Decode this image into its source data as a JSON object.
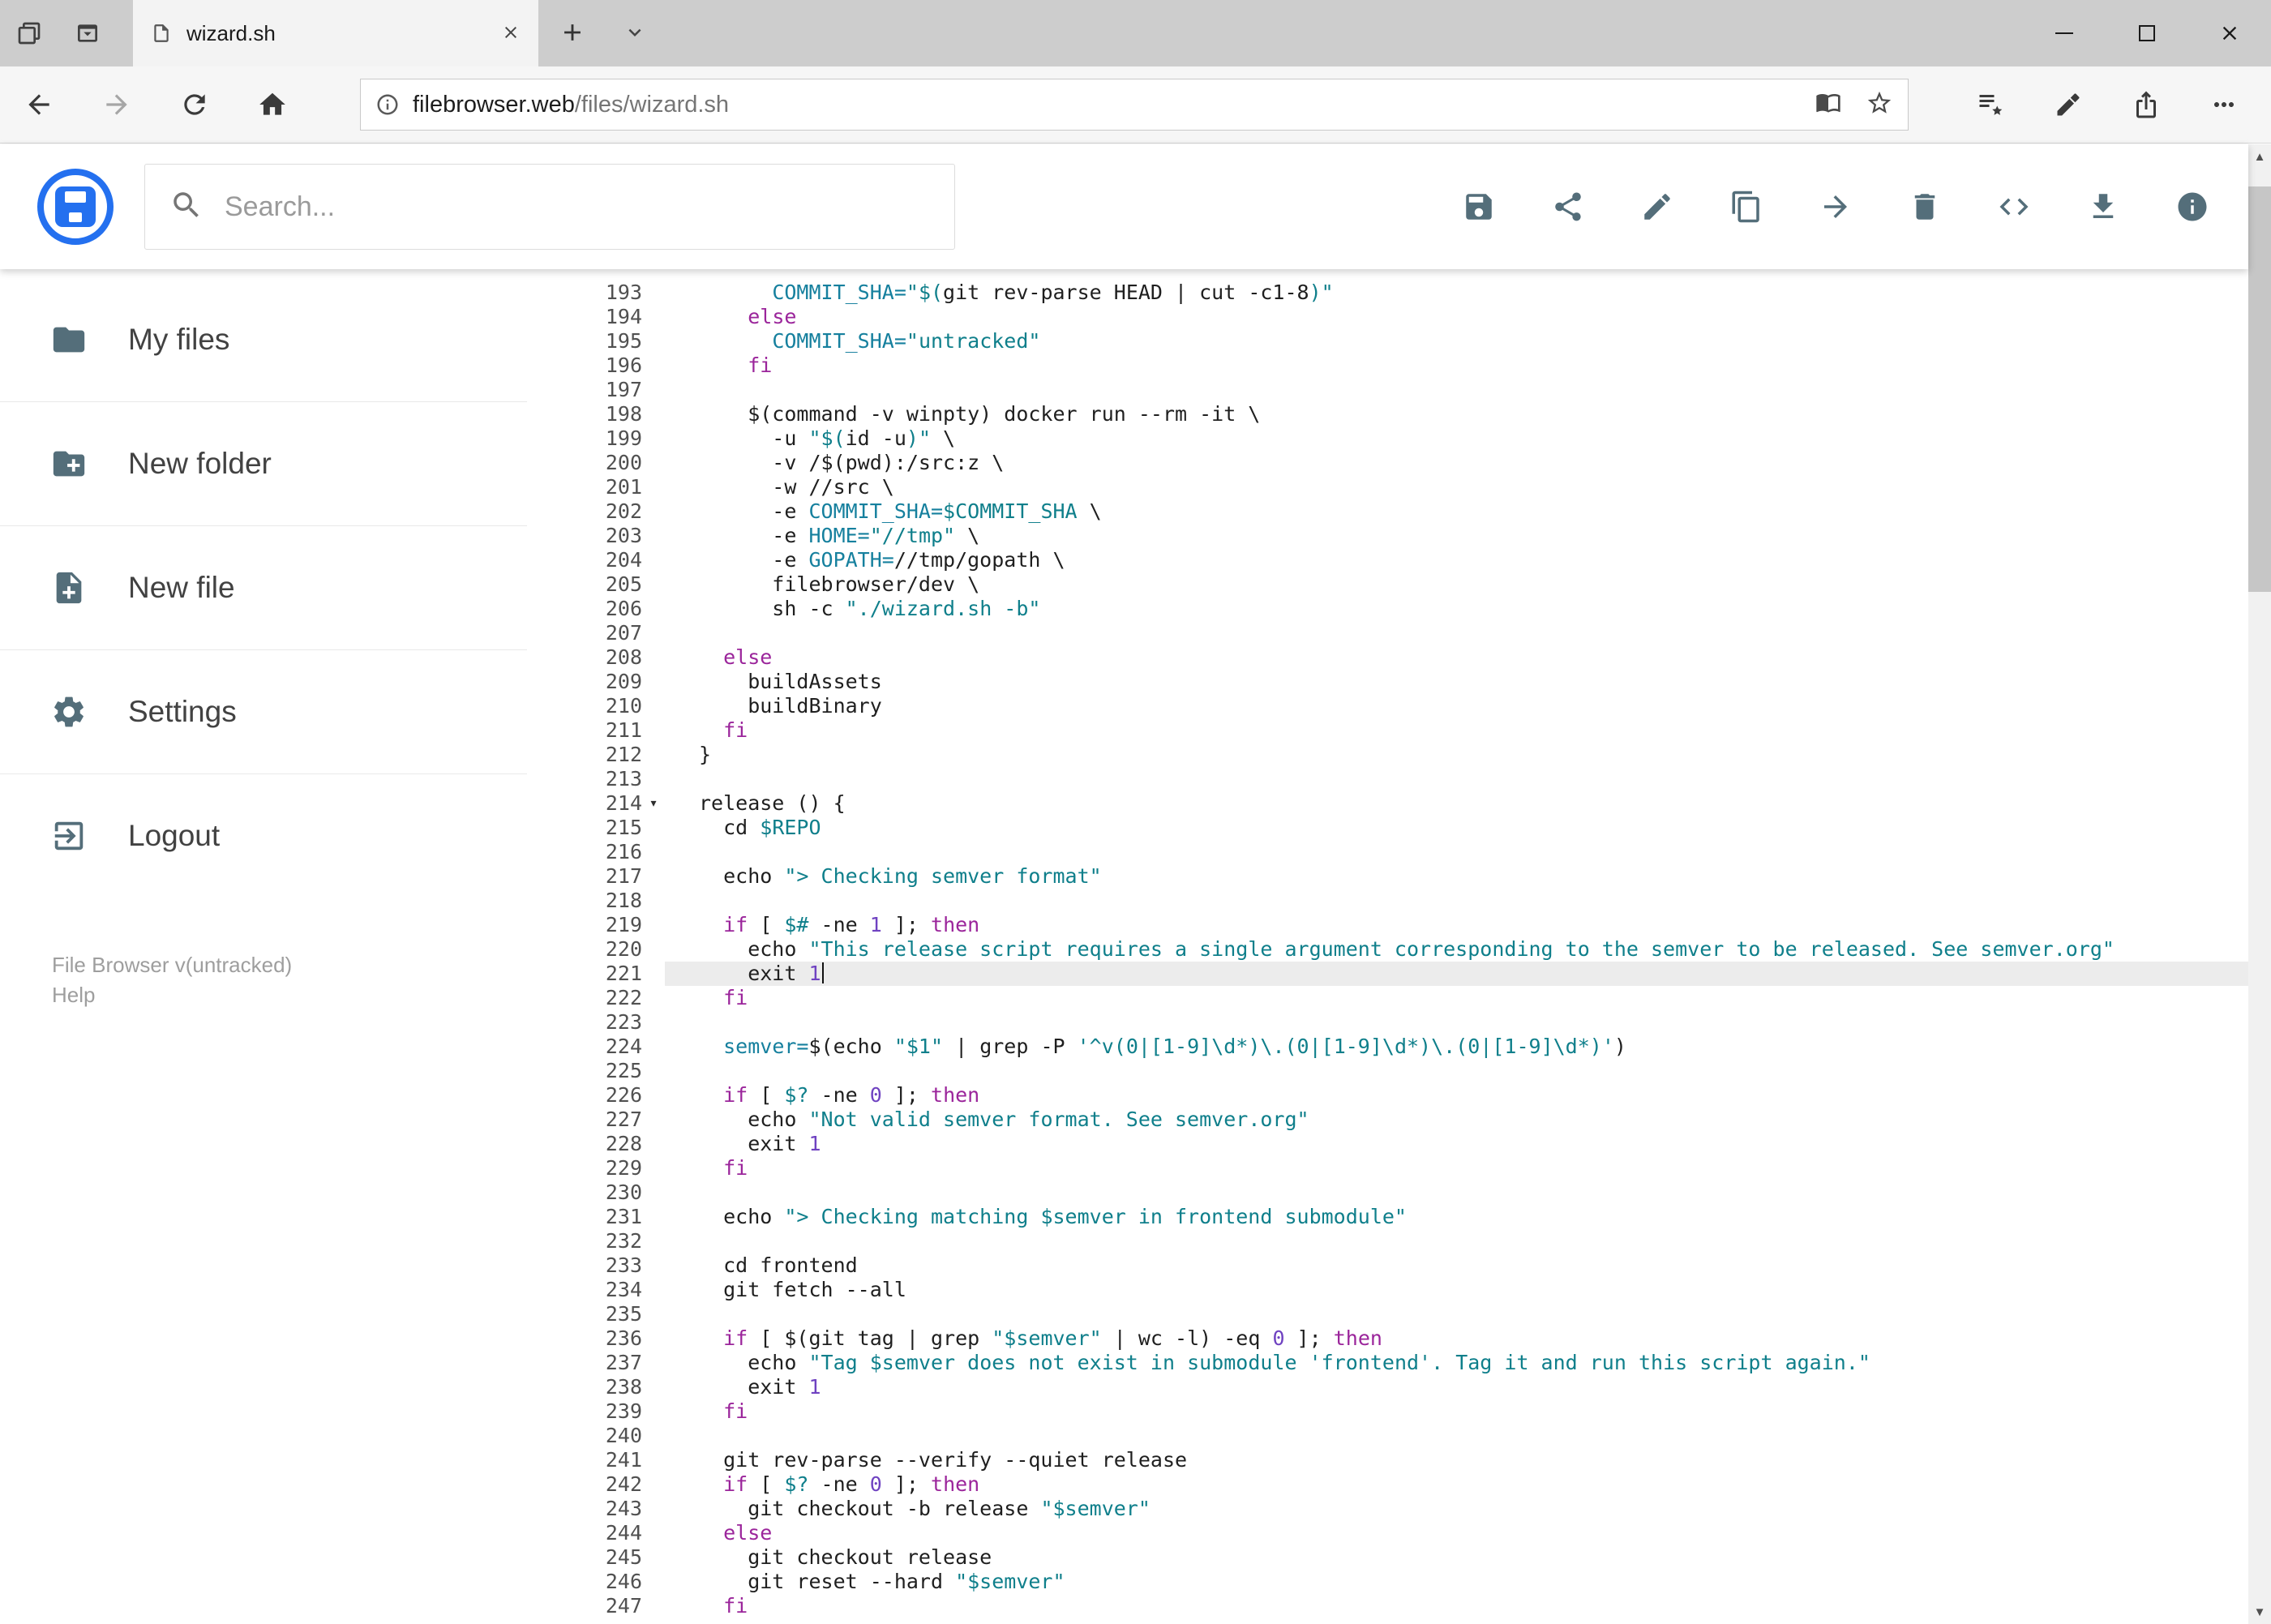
{
  "colors": {
    "brand_blue": "#2470ef",
    "toolbar_icon_gray": "#546e7a",
    "syntax_keyword": "#9b259b",
    "syntax_string": "#0f7f8b",
    "syntax_definition": "#16809e",
    "syntax_number": "#6f42c1",
    "syntax_plain": "#1f1f1f",
    "active_line_bg": "#ececec"
  },
  "browser": {
    "tab_title": "wizard.sh",
    "url_host": "filebrowser.web",
    "url_path": "/files/wizard.sh",
    "tabstrip_icons": [
      "tabs-aside-icon",
      "tab-preview-icon"
    ],
    "nav_icons": [
      "back-icon",
      "forward-icon",
      "refresh-icon",
      "home-icon"
    ],
    "address_icons": [
      "page-info-icon",
      "reading-view-icon",
      "favorite-star-icon"
    ],
    "action_icons": [
      "hub-icon",
      "web-note-icon",
      "share-browser-icon",
      "more-icon"
    ]
  },
  "app": {
    "search_placeholder": "Search...",
    "toolbar_icons": [
      "save-icon",
      "share-icon",
      "edit-icon",
      "copy-icon",
      "move-icon",
      "delete-icon",
      "code-icon",
      "download-icon",
      "info-icon"
    ]
  },
  "sidebar": {
    "items": [
      {
        "icon": "folder-icon",
        "label": "My files"
      },
      {
        "icon": "new-folder-icon",
        "label": "New folder"
      },
      {
        "icon": "new-file-icon",
        "label": "New file"
      },
      {
        "icon": "settings-icon",
        "label": "Settings"
      },
      {
        "icon": "logout-icon",
        "label": "Logout"
      }
    ],
    "footer": {
      "version": "File Browser v(untracked)",
      "help": "Help"
    }
  },
  "editor": {
    "active_line": 221,
    "fold_line": 214,
    "lines": [
      {
        "n": 193,
        "t": [
          [
            "p",
            "      "
          ],
          [
            "d",
            "COMMIT_SHA="
          ],
          [
            "s",
            "\"$("
          ],
          [
            "p",
            "git rev-parse HEAD | cut -c1-8"
          ],
          [
            "s",
            ")\""
          ]
        ]
      },
      {
        "n": 194,
        "t": [
          [
            "p",
            "    "
          ],
          [
            "k",
            "else"
          ]
        ]
      },
      {
        "n": 195,
        "t": [
          [
            "p",
            "      "
          ],
          [
            "d",
            "COMMIT_SHA="
          ],
          [
            "s",
            "\"untracked\""
          ]
        ]
      },
      {
        "n": 196,
        "t": [
          [
            "p",
            "    "
          ],
          [
            "k",
            "fi"
          ]
        ]
      },
      {
        "n": 197,
        "t": []
      },
      {
        "n": 198,
        "t": [
          [
            "p",
            "    $(command -v winpty) docker run --rm -it \\"
          ]
        ]
      },
      {
        "n": 199,
        "t": [
          [
            "p",
            "      -u "
          ],
          [
            "s",
            "\"$("
          ],
          [
            "p",
            "id -u"
          ],
          [
            "s",
            ")\""
          ],
          [
            "p",
            " \\"
          ]
        ]
      },
      {
        "n": 200,
        "t": [
          [
            "p",
            "      -v /$(pwd):/src:z \\"
          ]
        ]
      },
      {
        "n": 201,
        "t": [
          [
            "p",
            "      -w //src \\"
          ]
        ]
      },
      {
        "n": 202,
        "t": [
          [
            "p",
            "      -e "
          ],
          [
            "d",
            "COMMIT_SHA="
          ],
          [
            "v",
            "$COMMIT_SHA"
          ],
          [
            "p",
            " \\"
          ]
        ]
      },
      {
        "n": 203,
        "t": [
          [
            "p",
            "      -e "
          ],
          [
            "d",
            "HOME="
          ],
          [
            "s",
            "\"//tmp\""
          ],
          [
            "p",
            " \\"
          ]
        ]
      },
      {
        "n": 204,
        "t": [
          [
            "p",
            "      -e "
          ],
          [
            "d",
            "GOPATH="
          ],
          [
            "p",
            "//tmp/gopath \\"
          ]
        ]
      },
      {
        "n": 205,
        "t": [
          [
            "p",
            "      filebrowser/dev \\"
          ]
        ]
      },
      {
        "n": 206,
        "t": [
          [
            "p",
            "      sh -c "
          ],
          [
            "s",
            "\"./wizard.sh -b\""
          ]
        ]
      },
      {
        "n": 207,
        "t": []
      },
      {
        "n": 208,
        "t": [
          [
            "p",
            "  "
          ],
          [
            "k",
            "else"
          ]
        ]
      },
      {
        "n": 209,
        "t": [
          [
            "p",
            "    buildAssets"
          ]
        ]
      },
      {
        "n": 210,
        "t": [
          [
            "p",
            "    buildBinary"
          ]
        ]
      },
      {
        "n": 211,
        "t": [
          [
            "p",
            "  "
          ],
          [
            "k",
            "fi"
          ]
        ]
      },
      {
        "n": 212,
        "t": [
          [
            "p",
            "}"
          ]
        ]
      },
      {
        "n": 213,
        "t": []
      },
      {
        "n": 214,
        "t": [
          [
            "p",
            "release () {"
          ]
        ]
      },
      {
        "n": 215,
        "t": [
          [
            "p",
            "  cd "
          ],
          [
            "v",
            "$REPO"
          ]
        ]
      },
      {
        "n": 216,
        "t": []
      },
      {
        "n": 217,
        "t": [
          [
            "p",
            "  echo "
          ],
          [
            "s",
            "\"> Checking semver format\""
          ]
        ]
      },
      {
        "n": 218,
        "t": []
      },
      {
        "n": 219,
        "t": [
          [
            "p",
            "  "
          ],
          [
            "k",
            "if"
          ],
          [
            "p",
            " [ "
          ],
          [
            "v",
            "$#"
          ],
          [
            "p",
            " -ne "
          ],
          [
            "n",
            "1"
          ],
          [
            "p",
            " ]; "
          ],
          [
            "k",
            "then"
          ]
        ]
      },
      {
        "n": 220,
        "t": [
          [
            "p",
            "    echo "
          ],
          [
            "s",
            "\"This release script requires a single argument corresponding to the semver to be released. See semver.org\""
          ]
        ]
      },
      {
        "n": 221,
        "t": [
          [
            "p",
            "    exit "
          ],
          [
            "n",
            "1"
          ]
        ]
      },
      {
        "n": 222,
        "t": [
          [
            "p",
            "  "
          ],
          [
            "k",
            "fi"
          ]
        ]
      },
      {
        "n": 223,
        "t": []
      },
      {
        "n": 224,
        "t": [
          [
            "p",
            "  "
          ],
          [
            "d",
            "semver="
          ],
          [
            "p",
            "$(echo "
          ],
          [
            "s",
            "\"$1\""
          ],
          [
            "p",
            " | grep -P "
          ],
          [
            "s",
            "'^v(0|[1-9]\\d*)\\.(0|[1-9]\\d*)\\.(0|[1-9]\\d*)'"
          ],
          [
            "p",
            ")"
          ]
        ]
      },
      {
        "n": 225,
        "t": []
      },
      {
        "n": 226,
        "t": [
          [
            "p",
            "  "
          ],
          [
            "k",
            "if"
          ],
          [
            "p",
            " [ "
          ],
          [
            "v",
            "$?"
          ],
          [
            "p",
            " -ne "
          ],
          [
            "n",
            "0"
          ],
          [
            "p",
            " ]; "
          ],
          [
            "k",
            "then"
          ]
        ]
      },
      {
        "n": 227,
        "t": [
          [
            "p",
            "    echo "
          ],
          [
            "s",
            "\"Not valid semver format. See semver.org\""
          ]
        ]
      },
      {
        "n": 228,
        "t": [
          [
            "p",
            "    exit "
          ],
          [
            "n",
            "1"
          ]
        ]
      },
      {
        "n": 229,
        "t": [
          [
            "p",
            "  "
          ],
          [
            "k",
            "fi"
          ]
        ]
      },
      {
        "n": 230,
        "t": []
      },
      {
        "n": 231,
        "t": [
          [
            "p",
            "  echo "
          ],
          [
            "s",
            "\"> Checking matching "
          ],
          [
            "v",
            "$semver"
          ],
          [
            "s",
            " in frontend submodule\""
          ]
        ]
      },
      {
        "n": 232,
        "t": []
      },
      {
        "n": 233,
        "t": [
          [
            "p",
            "  cd frontend"
          ]
        ]
      },
      {
        "n": 234,
        "t": [
          [
            "p",
            "  git fetch --all"
          ]
        ]
      },
      {
        "n": 235,
        "t": []
      },
      {
        "n": 236,
        "t": [
          [
            "p",
            "  "
          ],
          [
            "k",
            "if"
          ],
          [
            "p",
            " [ $(git tag | grep "
          ],
          [
            "s",
            "\"$semver\""
          ],
          [
            "p",
            " | wc -l) -eq "
          ],
          [
            "n",
            "0"
          ],
          [
            "p",
            " ]; "
          ],
          [
            "k",
            "then"
          ]
        ]
      },
      {
        "n": 237,
        "t": [
          [
            "p",
            "    echo "
          ],
          [
            "s",
            "\"Tag "
          ],
          [
            "v",
            "$semver"
          ],
          [
            "s",
            " does not exist in submodule 'frontend'. Tag it and run this script again.\""
          ]
        ]
      },
      {
        "n": 238,
        "t": [
          [
            "p",
            "    exit "
          ],
          [
            "n",
            "1"
          ]
        ]
      },
      {
        "n": 239,
        "t": [
          [
            "p",
            "  "
          ],
          [
            "k",
            "fi"
          ]
        ]
      },
      {
        "n": 240,
        "t": []
      },
      {
        "n": 241,
        "t": [
          [
            "p",
            "  git rev-parse --verify --quiet release"
          ]
        ]
      },
      {
        "n": 242,
        "t": [
          [
            "p",
            "  "
          ],
          [
            "k",
            "if"
          ],
          [
            "p",
            " [ "
          ],
          [
            "v",
            "$?"
          ],
          [
            "p",
            " -ne "
          ],
          [
            "n",
            "0"
          ],
          [
            "p",
            " ]; "
          ],
          [
            "k",
            "then"
          ]
        ]
      },
      {
        "n": 243,
        "t": [
          [
            "p",
            "    git checkout -b release "
          ],
          [
            "s",
            "\"$semver\""
          ]
        ]
      },
      {
        "n": 244,
        "t": [
          [
            "p",
            "  "
          ],
          [
            "k",
            "else"
          ]
        ]
      },
      {
        "n": 245,
        "t": [
          [
            "p",
            "    git checkout release"
          ]
        ]
      },
      {
        "n": 246,
        "t": [
          [
            "p",
            "    git reset --hard "
          ],
          [
            "s",
            "\"$semver\""
          ]
        ]
      },
      {
        "n": 247,
        "t": [
          [
            "p",
            "  "
          ],
          [
            "k",
            "fi"
          ]
        ]
      }
    ]
  }
}
